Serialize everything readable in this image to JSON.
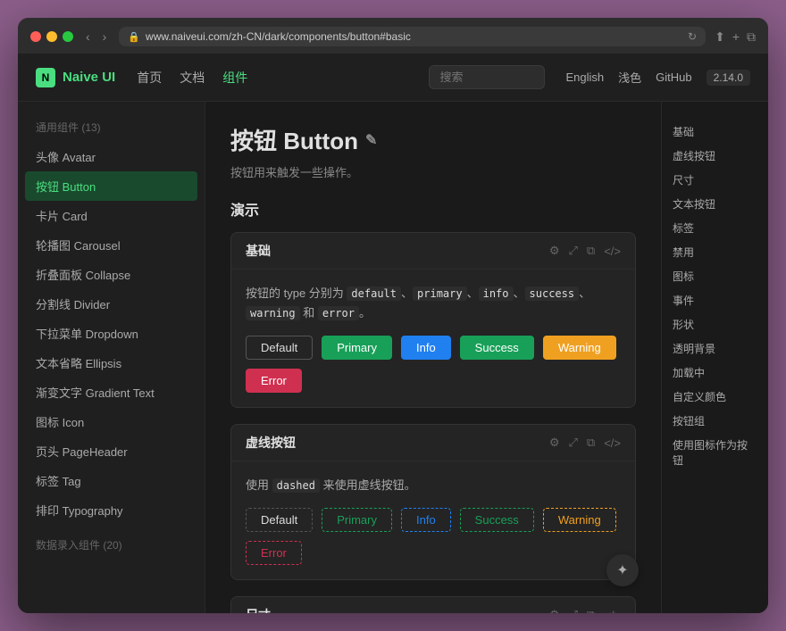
{
  "browser": {
    "address": "www.naiveui.com/zh-CN/dark/components/button#basic",
    "tab_label": "Naive UI"
  },
  "nav": {
    "logo_text": "Naive UI",
    "logo_icon": "N",
    "links": [
      {
        "label": "首页",
        "active": false
      },
      {
        "label": "文档",
        "active": false
      },
      {
        "label": "组件",
        "active": true
      }
    ],
    "search_placeholder": "搜索",
    "right_items": [
      {
        "label": "English"
      },
      {
        "label": "浅色"
      },
      {
        "label": "GitHub"
      }
    ],
    "version": "2.14.0"
  },
  "sidebar": {
    "section_title": "通用组件 (13)",
    "items": [
      {
        "label": "头像 Avatar",
        "active": false
      },
      {
        "label": "按钮 Button",
        "active": true
      },
      {
        "label": "卡片 Card",
        "active": false
      },
      {
        "label": "轮播图 Carousel",
        "active": false
      },
      {
        "label": "折叠面板 Collapse",
        "active": false
      },
      {
        "label": "分割线 Divider",
        "active": false
      },
      {
        "label": "下拉菜单 Dropdown",
        "active": false
      },
      {
        "label": "文本省略 Ellipsis",
        "active": false
      },
      {
        "label": "渐变文字 Gradient Text",
        "active": false
      },
      {
        "label": "图标 Icon",
        "active": false
      },
      {
        "label": "页头 PageHeader",
        "active": false
      },
      {
        "label": "标签 Tag",
        "active": false
      },
      {
        "label": "排印 Typography",
        "active": false
      }
    ],
    "bottom_section": "数据录入组件 (20)"
  },
  "page": {
    "title": "按钮 Button",
    "edit_icon": "✎",
    "description": "按钮用来触发一些操作。",
    "demo_section_title": "演示"
  },
  "demo_basic": {
    "card_title": "基础",
    "description_parts": [
      "按钮的 type 分别为 ",
      "default",
      "、",
      "primary",
      "、",
      "info",
      "、",
      "success",
      "、",
      "warning",
      " 和 ",
      "error",
      "。"
    ],
    "buttons": [
      {
        "label": "Default",
        "type": "default"
      },
      {
        "label": "Primary",
        "type": "primary"
      },
      {
        "label": "Info",
        "type": "info"
      },
      {
        "label": "Success",
        "type": "success"
      },
      {
        "label": "Warning",
        "type": "warning"
      },
      {
        "label": "Error",
        "type": "error"
      }
    ]
  },
  "demo_dashed": {
    "card_title": "虚线按钮",
    "description": "使用 dashed 来使用虚线按钮。",
    "dashed_keyword": "dashed",
    "buttons": [
      {
        "label": "Default",
        "type": "dashed-default"
      },
      {
        "label": "Primary",
        "type": "dashed-primary"
      },
      {
        "label": "Info",
        "type": "dashed-info"
      },
      {
        "label": "Success",
        "type": "dashed-success"
      },
      {
        "label": "Warning",
        "type": "dashed-warning"
      },
      {
        "label": "Error",
        "type": "dashed-error"
      }
    ]
  },
  "demo_size": {
    "card_title": "尺寸"
  },
  "right_sidebar": {
    "items": [
      {
        "label": "基础"
      },
      {
        "label": "虚线按钮"
      },
      {
        "label": "尺寸"
      },
      {
        "label": "文本按钮"
      },
      {
        "label": "标签"
      },
      {
        "label": "禁用"
      },
      {
        "label": "图标"
      },
      {
        "label": "事件"
      },
      {
        "label": "形状"
      },
      {
        "label": "透明背景"
      },
      {
        "label": "加载中"
      },
      {
        "label": "自定义颜色"
      },
      {
        "label": "按钮组"
      },
      {
        "label": "使用图标作为按钮"
      }
    ]
  },
  "floating_btn": {
    "icon": "✦"
  }
}
